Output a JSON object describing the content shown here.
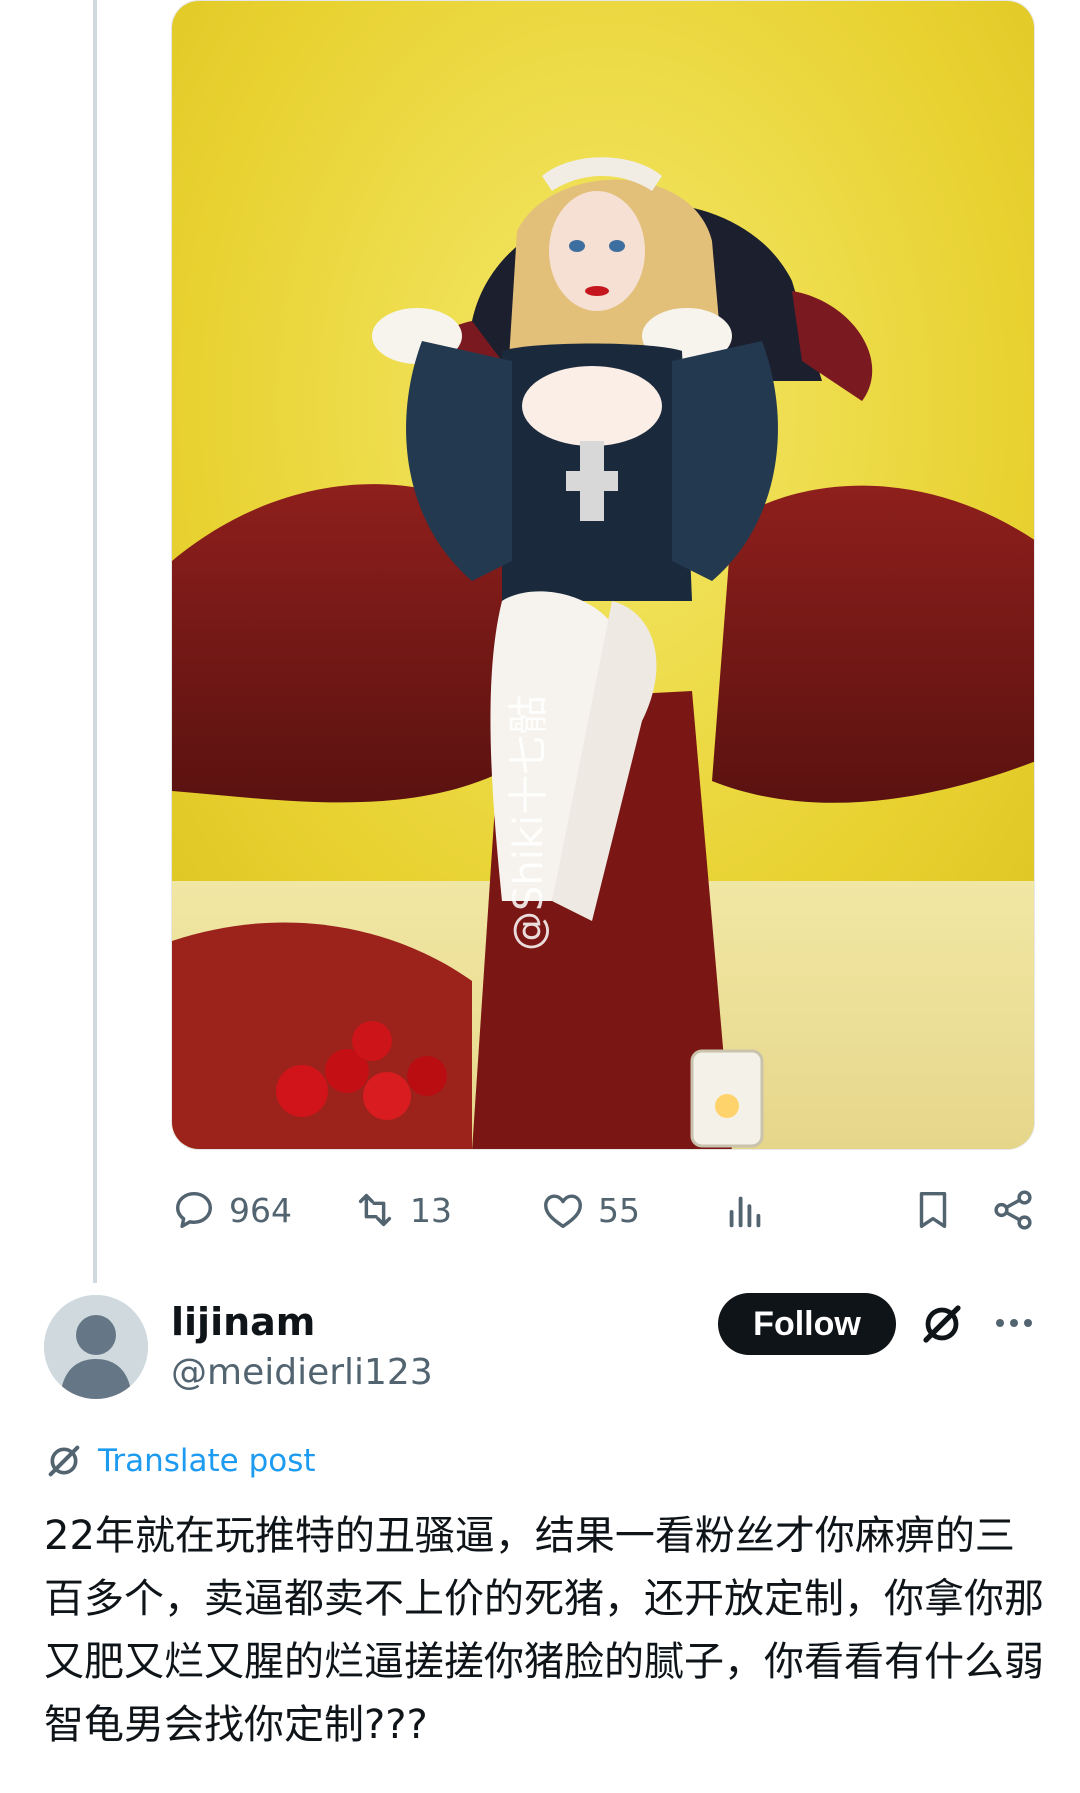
{
  "post": {
    "media_watermark": "@Shiki十七骷",
    "counts": {
      "replies": "964",
      "reposts": "13",
      "likes": "55"
    }
  },
  "reply": {
    "display_name": "lijinam",
    "handle": "@meidierli123",
    "follow_label": "Follow",
    "translate_label": "Translate post",
    "text": "22年就在玩推特的丑骚逼，结果一看粉丝才你麻痹的三百多个，卖逼都卖不上价的死猪，还开放定制，你拿你那又肥又烂又腥的烂逼搓搓你猪脸的腻子，你看看有什么弱智龟男会找你定制???"
  },
  "icons": {
    "reply": "speech-bubble-icon",
    "repost": "repost-arrows-icon",
    "like": "heart-icon",
    "views": "bar-chart-icon",
    "bookmark": "bookmark-icon",
    "share": "share-icon",
    "grok": "grok-slash-icon",
    "more": "more-dots-icon",
    "translate": "grok-slash-icon"
  },
  "colors": {
    "accent": "#1d9bf0",
    "text_primary": "#0f1419",
    "text_secondary": "#536471",
    "follow_bg": "#0f1419",
    "thread_line": "#cfd9de"
  }
}
